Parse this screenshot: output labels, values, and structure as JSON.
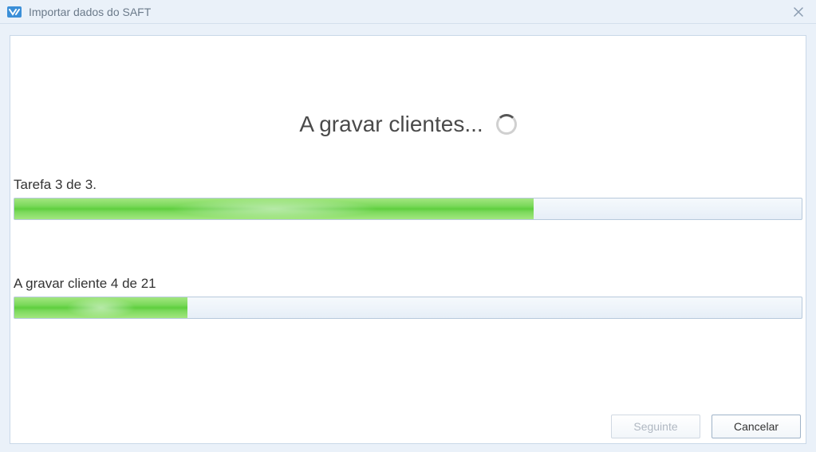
{
  "window": {
    "title": "Importar dados do SAFT"
  },
  "status": {
    "message": "A gravar clientes..."
  },
  "task": {
    "label": "Tarefa 3 de 3.",
    "percent": 66
  },
  "subtask": {
    "label": "A gravar cliente 4 de 21",
    "percent": 22
  },
  "buttons": {
    "next": "Seguinte",
    "cancel": "Cancelar"
  },
  "colors": {
    "accent_green": "#6fd14f",
    "panel_bg": "#ffffff",
    "window_bg": "#eaf1f9"
  }
}
